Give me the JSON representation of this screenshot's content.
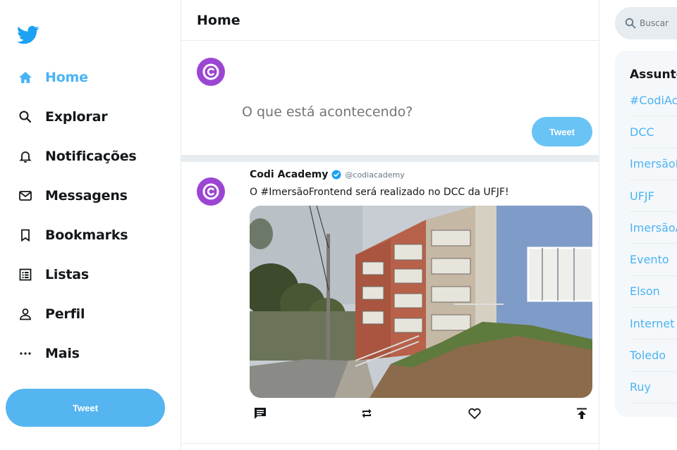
{
  "sidebar": {
    "items": [
      {
        "label": "Home",
        "icon": "home-icon",
        "active": true
      },
      {
        "label": "Explorar",
        "icon": "search-icon"
      },
      {
        "label": "Notificações",
        "icon": "bell-icon"
      },
      {
        "label": "Messagens",
        "icon": "mail-icon"
      },
      {
        "label": "Bookmarks",
        "icon": "bookmark-icon"
      },
      {
        "label": "Listas",
        "icon": "list-icon"
      },
      {
        "label": "Perfil",
        "icon": "user-icon"
      },
      {
        "label": "Mais",
        "icon": "more-icon"
      }
    ],
    "tweet_label": "Tweet"
  },
  "main": {
    "title": "Home",
    "composer": {
      "placeholder": "O que está acontecendo?",
      "tweet_label": "Tweet"
    },
    "tweet": {
      "name": "Codi Academy",
      "handle": "@codiacademy",
      "text": "O #ImersãoFrontend será realizado no DCC da UFJF!"
    }
  },
  "right": {
    "search_placeholder": "Buscar",
    "topics_title": "Assuntos",
    "topics": [
      "#CodiAcademy",
      "DCC",
      "ImersãoFrontend",
      "UFJF",
      "ImersãoAcademy",
      "Evento",
      "Elson",
      "Internet",
      "Toledo",
      "Ruy"
    ]
  },
  "colors": {
    "accent": "#4ab3f4",
    "button": "#55b5f0",
    "avatar": "#9b46d2",
    "border": "#e6ecf0"
  }
}
